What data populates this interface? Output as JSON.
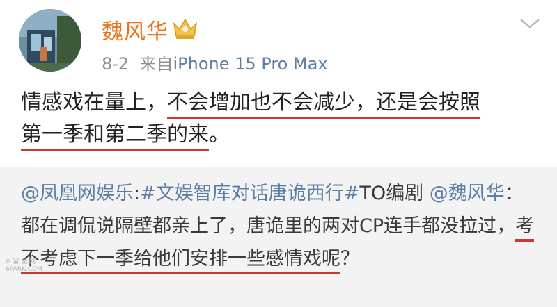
{
  "user": {
    "name": "魏风华"
  },
  "meta": {
    "date": "8-2",
    "via": "来自",
    "device": "iPhone 15 Pro Max"
  },
  "icons": {
    "badge": "vip-crown-icon",
    "menu": "chevron-down-icon"
  },
  "post": {
    "part1": "情感戏在量上，",
    "underlined1": "不会增加也不会减少，还是会按照",
    "underlined2": "第一季和第二季的来",
    "end": "。"
  },
  "repost": {
    "mention": "@凤凰网娱乐",
    "colon": ":",
    "hashtag": "#文娱智库对话唐诡西行#",
    "text1": "TO编剧 ",
    "mention2": "@魏风华",
    "text2": "：都在调侃说隔壁都亲上了，唐诡里的两对CP连手都没拉过，",
    "underlined1": "考不考虑下一季给他们安排一些感情",
    "underlined2": "戏呢",
    "end": "？"
  },
  "watermark": {
    "line1": "⊕ 留 园 网",
    "line2": "6PARK.COM"
  },
  "colors": {
    "username": "#e8741c",
    "link": "#5d7fa3",
    "underline": "#c83a2f",
    "repost_bg": "#f3f3f3"
  }
}
